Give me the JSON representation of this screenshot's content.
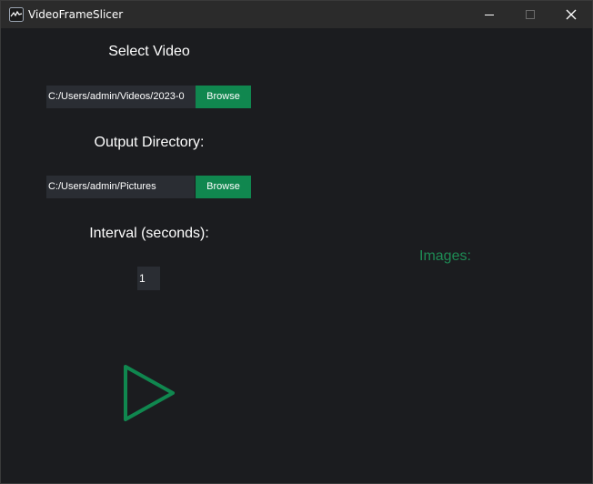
{
  "window": {
    "title": "VideoFrameSlicer",
    "icon": "app-waveform-icon",
    "controls": [
      "minimize-icon",
      "maximize-icon",
      "close-icon"
    ]
  },
  "video": {
    "label": "Select Video",
    "path": "C:/Users/admin/Videos/2023-0",
    "browse_label": "Browse"
  },
  "output": {
    "label": "Output Directory:",
    "path": "C:/Users/admin/Pictures",
    "browse_label": "Browse"
  },
  "interval": {
    "label": "Interval (seconds):",
    "value": "1"
  },
  "images": {
    "label": "Images:"
  },
  "play": {
    "icon": "play-icon"
  },
  "colors": {
    "accent": "#10874f",
    "background": "#1b1c1f",
    "field": "#2a2d33",
    "images_label": "#1e8c55"
  }
}
